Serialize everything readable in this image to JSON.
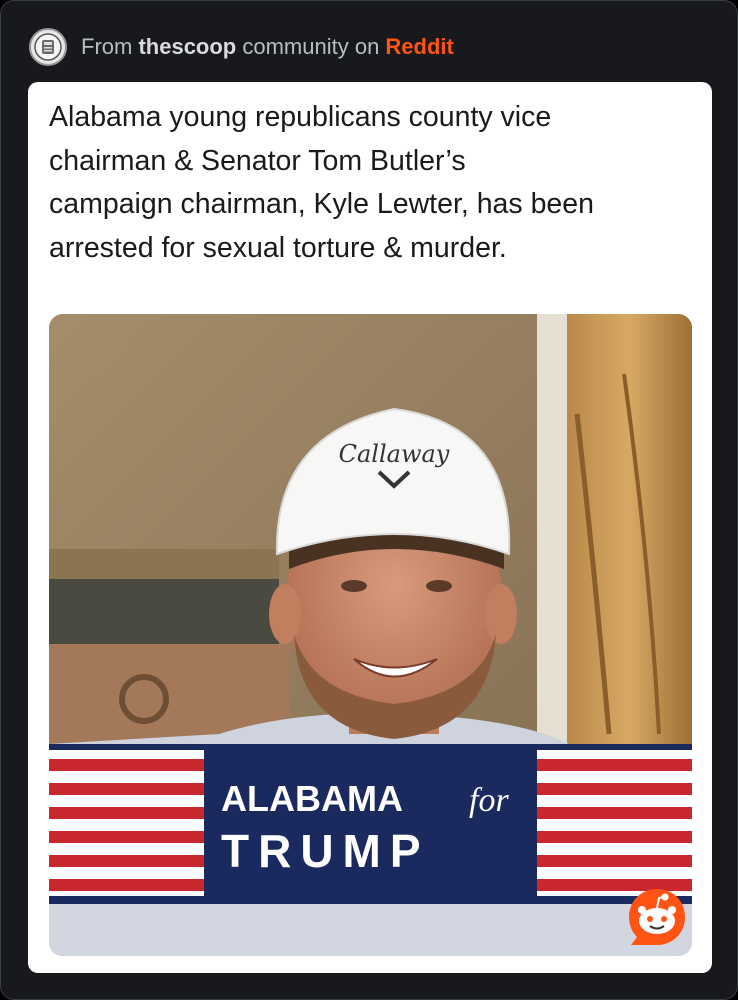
{
  "header": {
    "prefix": "From ",
    "community": "thescoop",
    "middle": " community on ",
    "platform": "Reddit",
    "avatar_icon": "community-avatar-icon"
  },
  "post": {
    "lines": [
      "Alabama young republicans county vice",
      "chairman & Senator Tom Butler’s",
      "campaign chairman, Kyle Lewter, has been",
      "arrested for sexual torture & murder."
    ]
  },
  "image": {
    "cap_logo": "Callaway",
    "banner_line1": "ALABAMA",
    "banner_for": "for",
    "banner_line2": "TRUMP"
  },
  "colors": {
    "background": "#17191c",
    "card": "#ffffff",
    "reddit_orange": "#ff5414",
    "banner_navy": "#1b2a5e",
    "stripe_red": "#c8282e"
  },
  "icons": {
    "reddit": "reddit-snoo-icon"
  }
}
